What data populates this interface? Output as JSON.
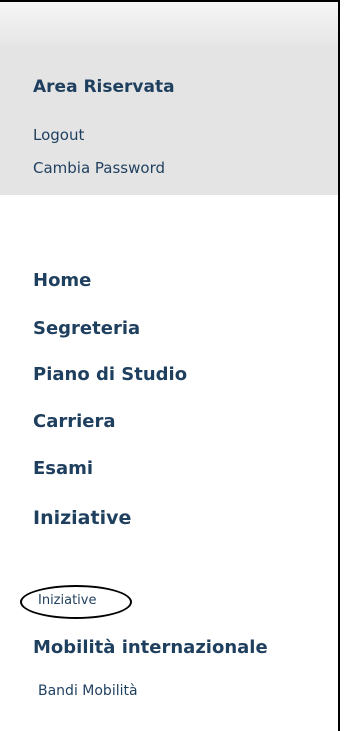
{
  "reserved_area": {
    "title": "Area Riservata",
    "logout": "Logout",
    "change_password": "Cambia Password"
  },
  "nav": {
    "home": "Home",
    "secretariat": "Segreteria",
    "study_plan": "Piano di Studio",
    "career": "Carriera",
    "exams": "Esami",
    "initiatives": "Iniziative",
    "initiatives_sub": "Iniziative",
    "international_mobility": "Mobilità internazionale",
    "mobility_calls": "Bandi Mobilità"
  },
  "colors": {
    "link": "#1f3f5f",
    "panel_bg": "#e4e4e4"
  }
}
